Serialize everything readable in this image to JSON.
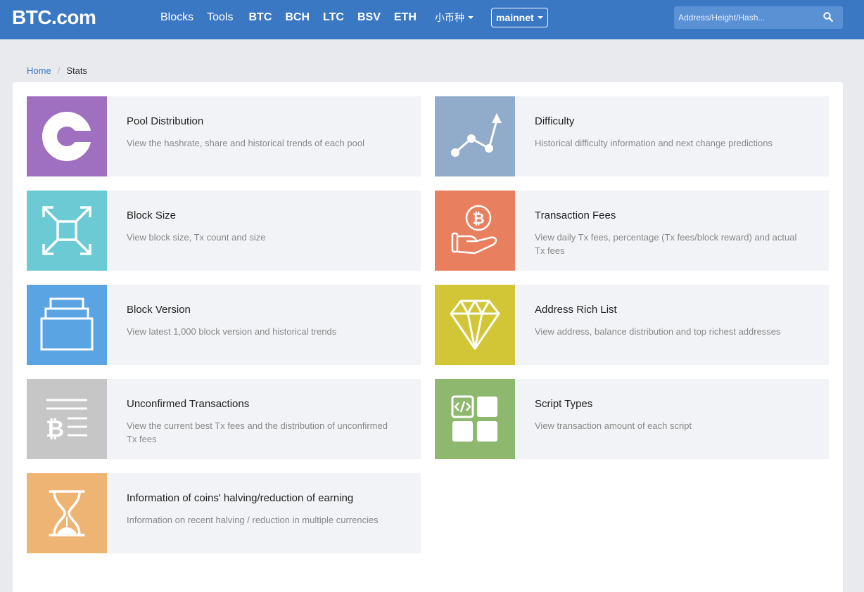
{
  "header": {
    "logo": "BTC.com",
    "nav": [
      "Blocks",
      "Tools",
      "BTC",
      "BCH",
      "LTC",
      "BSV",
      "ETH"
    ],
    "small_coins": "小币种",
    "network": "mainnet",
    "search_placeholder": "Address/Height/Hash..."
  },
  "breadcrumb": {
    "home": "Home",
    "separator": "/",
    "current": "Stats"
  },
  "cards": [
    {
      "title": "Pool Distribution",
      "desc": "View the hashrate,  share and historical trends of each pool",
      "color": "#a070c0",
      "icon": "pie-chart-icon"
    },
    {
      "title": "Difficulty",
      "desc": "Historical difficulty information and next change predictions",
      "color": "#90acca",
      "icon": "trend-line-icon"
    },
    {
      "title": "Block Size",
      "desc": "View block size,  Tx count and size",
      "color": "#6ccad4",
      "icon": "expand-arrows-icon"
    },
    {
      "title": "Transaction Fees",
      "desc": "View daily Tx fees,  percentage (Tx fees/block reward) and actual Tx fees",
      "color": "#e88060",
      "icon": "hand-bitcoin-icon"
    },
    {
      "title": "Block Version",
      "desc": "View latest 1,000 block version and historical trends",
      "color": "#5aa4e4",
      "icon": "stacked-layers-icon"
    },
    {
      "title": "Address Rich List",
      "desc": "View address,  balance distribution and top richest addresses",
      "color": "#d2c636",
      "icon": "diamond-icon"
    },
    {
      "title": "Unconfirmed Transactions",
      "desc": "View the current best Tx fees and the distribution of unconfirmed Tx fees",
      "color": "#c6c6c6",
      "icon": "bitcoin-list-icon"
    },
    {
      "title": "Script Types",
      "desc": "View transaction amount of each script",
      "color": "#8eb86e",
      "icon": "code-blocks-icon"
    },
    {
      "title": "Information of coins' halving/reduction of earning",
      "desc": "Information on recent halving / reduction in multiple currencies",
      "color": "#eeb474",
      "icon": "hourglass-icon"
    }
  ]
}
